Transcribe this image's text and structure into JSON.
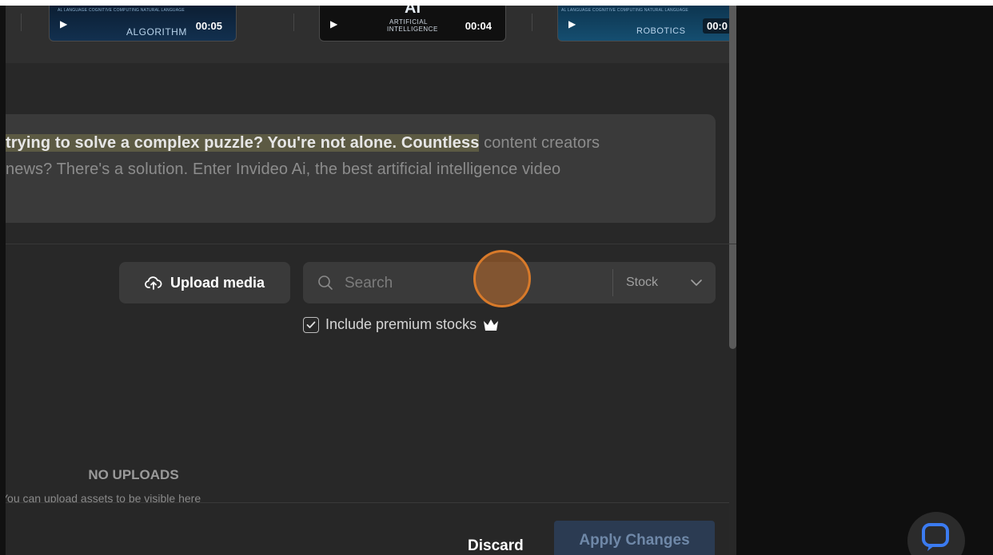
{
  "thumbnails": [
    {
      "top_text": "AL LANGUAGE   COGNITIVE COMPUTING   NATURAL LANGUAGE",
      "subtitle": "ALGORITHM",
      "duration": "00:05"
    },
    {
      "top_text": "AI",
      "subtitle": "ARTIFICIAL INTELLIGENCE",
      "duration": "00:04"
    },
    {
      "top_text": "AL LANGUAGE   COGNITIVE COMPUTING   NATURAL LANGUAGE",
      "subtitle": "ROBOTICS",
      "duration": "00:0"
    }
  ],
  "script": {
    "line1_highlight": "trying to solve a complex puzzle? You're not alone. Countless",
    "line1_rest": " content creators",
    "line2": "news? There's a solution. Enter Invideo Ai, the best artificial intelligence video"
  },
  "toolbar": {
    "upload_label": "Upload media",
    "search_placeholder": "Search",
    "source_label": "Stock",
    "premium_label": "Include premium stocks",
    "premium_checked": true
  },
  "uploads": {
    "empty_title": "NO UPLOADS",
    "empty_subtitle": "You can upload assets to be visible here"
  },
  "footer": {
    "discard_label": "Discard",
    "apply_label": "Apply Changes"
  },
  "colors": {
    "panel_bg": "#282828",
    "highlight_bg": "#5c5a43",
    "apply_bg": "#2b3b52",
    "cursor_ring": "#d87a2a"
  }
}
